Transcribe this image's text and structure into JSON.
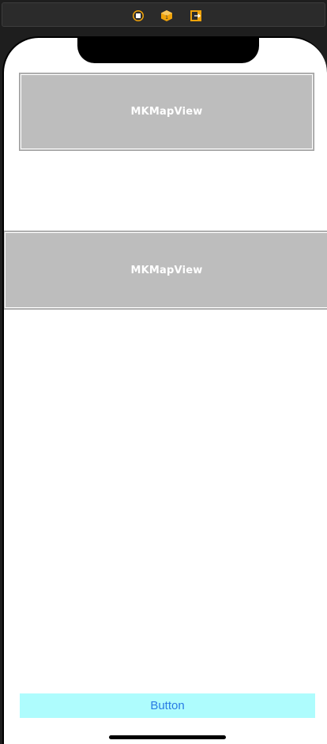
{
  "scene_dock": {
    "icons": [
      "view-controller-icon",
      "first-responder-icon",
      "exit-icon"
    ]
  },
  "views": {
    "map_view_top": {
      "label": "MKMapView"
    },
    "map_view_middle": {
      "label": "MKMapView"
    }
  },
  "button": {
    "label": "Button"
  },
  "colors": {
    "map_placeholder": "#bdbdbd",
    "button_background": "#aefcfd",
    "button_text": "#2a7be4",
    "dock_icon": "#f0a30a"
  }
}
